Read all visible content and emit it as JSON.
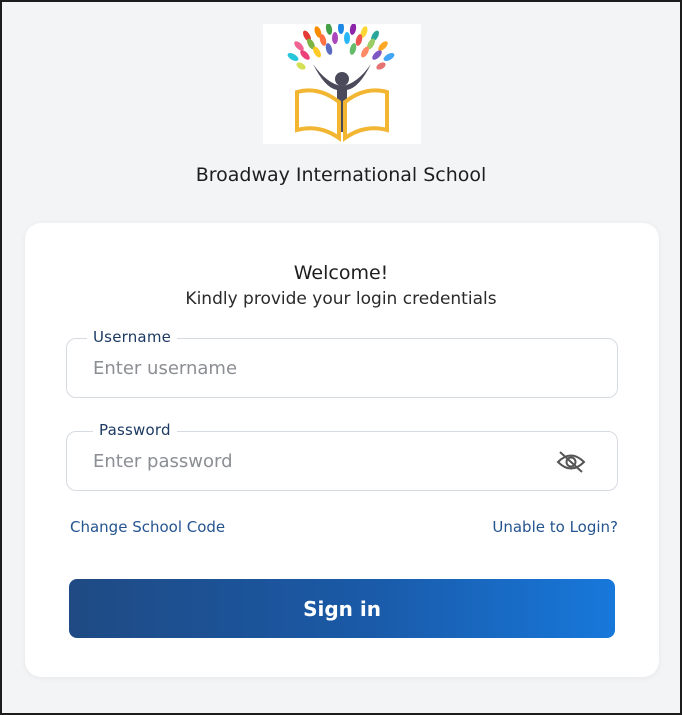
{
  "school": {
    "name": "Broadway International School"
  },
  "login": {
    "welcome": "Welcome!",
    "subtitle": "Kindly provide your login credentials",
    "username_label": "Username",
    "username_placeholder": "Enter username",
    "username_value": "",
    "password_label": "Password",
    "password_placeholder": "Enter password",
    "password_value": "",
    "change_school_code": "Change School Code",
    "unable_to_login": "Unable to Login?",
    "sign_in": "Sign in"
  },
  "icons": {
    "logo": "tree-book-logo",
    "password_toggle": "eye-off-icon"
  },
  "colors": {
    "primary": "#1f4a83",
    "primary_end": "#1778db",
    "link": "#24548f",
    "label": "#1d3a63"
  }
}
